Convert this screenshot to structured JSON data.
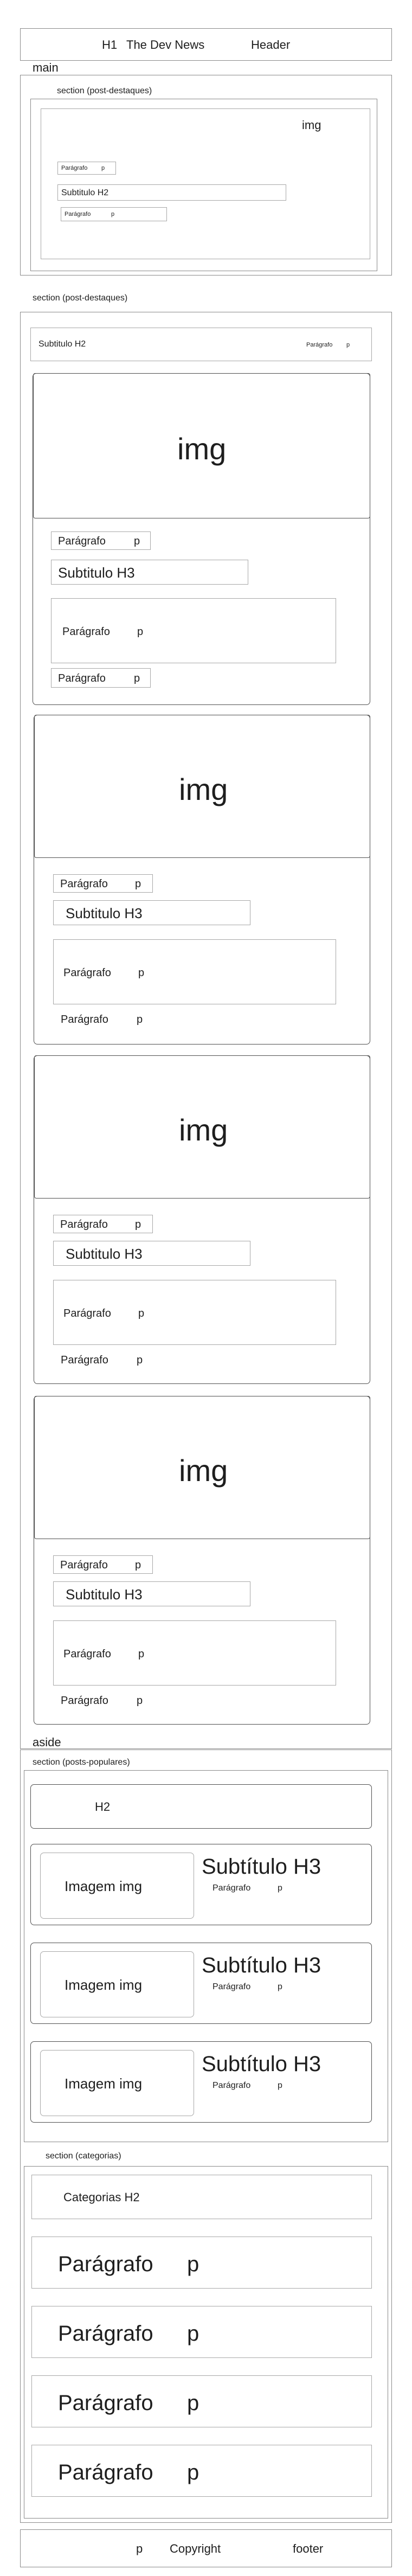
{
  "header": {
    "h1": "H1",
    "title": "The Dev News",
    "tag": "Header"
  },
  "main": {
    "label": "main",
    "featured": {
      "label": "section (post-destaques)",
      "img": "img",
      "p1": "Parágrafo",
      "p1_tag": "p",
      "subtitle": "Subtitulo H2",
      "p2": "Parágrafo",
      "p2_tag": "p"
    },
    "posts": {
      "label": "section (post-destaques)",
      "header_subtitle": "Subtitulo H2",
      "header_p": "Parágrafo",
      "header_p_tag": "p",
      "articles": [
        {
          "img": "img",
          "p_top": "Parágrafo",
          "p_top_tag": "p",
          "subtitle": "Subtitulo H3",
          "p_mid": "Parágrafo",
          "p_mid_tag": "p",
          "p_bot": "Parágrafo",
          "p_bot_tag": "p"
        },
        {
          "img": "img",
          "p_top": "Parágrafo",
          "p_top_tag": "p",
          "subtitle": "Subtitulo H3",
          "p_mid": "Parágrafo",
          "p_mid_tag": "p",
          "p_bot": "Parágrafo",
          "p_bot_tag": "p"
        },
        {
          "img": "img",
          "p_top": "Parágrafo",
          "p_top_tag": "p",
          "subtitle": "Subtitulo H3",
          "p_mid": "Parágrafo",
          "p_mid_tag": "p",
          "p_bot": "Parágrafo",
          "p_bot_tag": "p"
        },
        {
          "img": "img",
          "p_top": "Parágrafo",
          "p_top_tag": "p",
          "subtitle": "Subtitulo H3",
          "p_mid": "Parágrafo",
          "p_mid_tag": "p",
          "p_bot": "Parágrafo",
          "p_bot_tag": "p"
        }
      ]
    }
  },
  "aside": {
    "label": "aside",
    "popular": {
      "label": "section (posts-populares)",
      "h2": "H2",
      "cards": [
        {
          "img": "Imagem img",
          "subtitle": "Subtítulo H3",
          "p": "Parágrafo",
          "p_tag": "p"
        },
        {
          "img": "Imagem img",
          "subtitle": "Subtítulo H3",
          "p": "Parágrafo",
          "p_tag": "p"
        },
        {
          "img": "Imagem img",
          "subtitle": "Subtítulo H3",
          "p": "Parágrafo",
          "p_tag": "p"
        }
      ]
    },
    "categories": {
      "label": "section (categorias)",
      "h2": "Categorias H2",
      "items": [
        {
          "text": "Parágrafo",
          "tag": "p"
        },
        {
          "text": "Parágrafo",
          "tag": "p"
        },
        {
          "text": "Parágrafo",
          "tag": "p"
        },
        {
          "text": "Parágrafo",
          "tag": "p"
        }
      ]
    }
  },
  "footer": {
    "p": "p",
    "copyright": "Copyright",
    "tag": "footer"
  }
}
